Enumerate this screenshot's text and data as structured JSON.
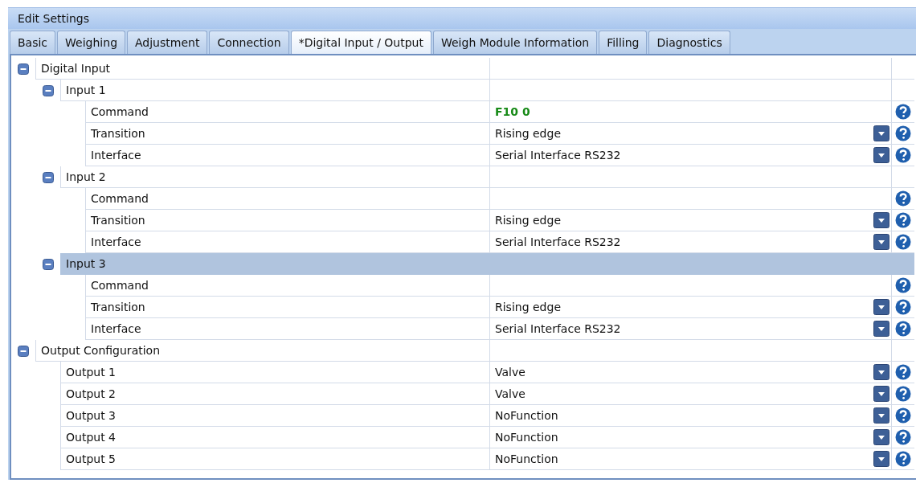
{
  "window": {
    "title": "Edit Settings"
  },
  "tabs": [
    {
      "label": "Basic",
      "selected": false
    },
    {
      "label": "Weighing",
      "selected": false
    },
    {
      "label": "Adjustment",
      "selected": false
    },
    {
      "label": "Connection",
      "selected": false
    },
    {
      "label": "*Digital Input / Output",
      "selected": true
    },
    {
      "label": "Weigh Module Information",
      "selected": false
    },
    {
      "label": "Filling",
      "selected": false
    },
    {
      "label": "Diagnostics",
      "selected": false
    }
  ],
  "tree": [
    {
      "label": "Digital Input",
      "expanded": true,
      "selected": false,
      "children": [
        {
          "label": "Input 1",
          "expanded": true,
          "selected": false,
          "children": [
            {
              "label": "Command",
              "kind": "command",
              "value": "F10 0"
            },
            {
              "label": "Transition",
              "kind": "dropdown",
              "value": "Rising edge"
            },
            {
              "label": "Interface",
              "kind": "dropdown",
              "value": "Serial Interface RS232"
            }
          ]
        },
        {
          "label": "Input 2",
          "expanded": true,
          "selected": false,
          "children": [
            {
              "label": "Command",
              "kind": "command"
            },
            {
              "label": "Transition",
              "kind": "dropdown",
              "value": "Rising edge"
            },
            {
              "label": "Interface",
              "kind": "dropdown",
              "value": "Serial Interface RS232"
            }
          ]
        },
        {
          "label": "Input 3",
          "expanded": true,
          "selected": true,
          "children": [
            {
              "label": "Command",
              "kind": "command"
            },
            {
              "label": "Transition",
              "kind": "dropdown",
              "value": "Rising edge"
            },
            {
              "label": "Interface",
              "kind": "dropdown",
              "value": "Serial Interface RS232"
            }
          ]
        }
      ]
    },
    {
      "label": "Output Configuration",
      "expanded": true,
      "selected": false,
      "children": [
        {
          "label": "Output 1",
          "kind": "dropdown",
          "value": "Valve"
        },
        {
          "label": "Output 2",
          "kind": "dropdown",
          "value": "Valve"
        },
        {
          "label": "Output 3",
          "kind": "dropdown",
          "value": "NoFunction"
        },
        {
          "label": "Output 4",
          "kind": "dropdown",
          "value": "NoFunction"
        },
        {
          "label": "Output 5",
          "kind": "dropdown",
          "value": "NoFunction"
        }
      ]
    }
  ]
}
